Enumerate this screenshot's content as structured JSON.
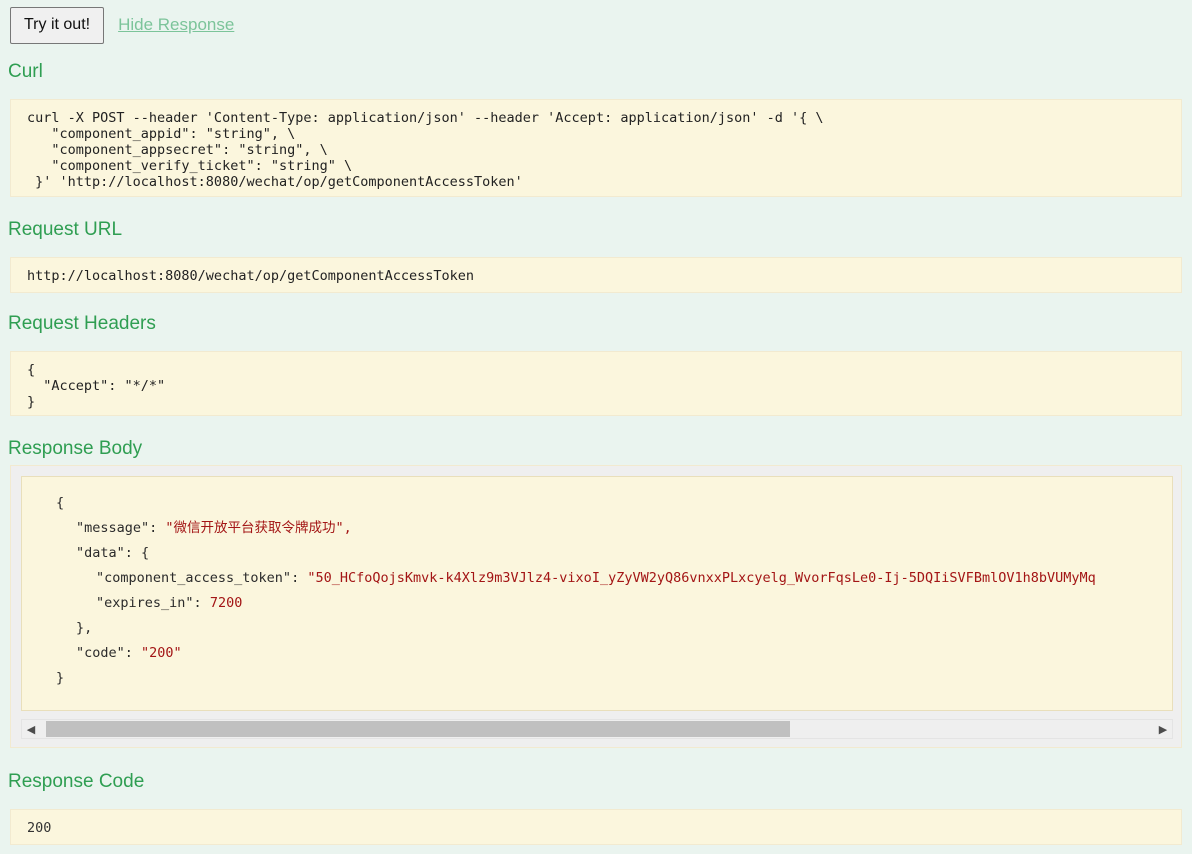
{
  "actions": {
    "try_it_out_label": "Try it out!",
    "hide_response_label": "Hide Response"
  },
  "sections": {
    "curl": {
      "title": "Curl",
      "lines": [
        "curl -X POST --header 'Content-Type: application/json' --header 'Accept: application/json' -d '{ \\",
        "   \"component_appid\": \"string\", \\",
        "   \"component_appsecret\": \"string\", \\",
        "   \"component_verify_ticket\": \"string\" \\",
        " }' 'http://localhost:8080/wechat/op/getComponentAccessToken'"
      ]
    },
    "request_url": {
      "title": "Request URL",
      "value": "http://localhost:8080/wechat/op/getComponentAccessToken"
    },
    "request_headers": {
      "title": "Request Headers",
      "value": "{\n  \"Accept\": \"*/*\"\n}"
    },
    "response_body": {
      "title": "Response Body",
      "lines": {
        "open_brace": "{",
        "message_key": "\"message\":",
        "message_val": "\"微信开放平台获取令牌成功\",",
        "data_key": "\"data\": {",
        "token_key": "\"component_access_token\":",
        "token_val": "\"50_HCfoQojsKmvk-k4Xlz9m3VJlz4-vixoI_yZyVW2yQ86vnxxPLxcyelg_WvorFqsLe0-Ij-5DQIiSVFBmlOV1h8bVUMyMq",
        "expires_key": "\"expires_in\":",
        "expires_val": "7200",
        "data_close": "},",
        "code_key": "\"code\":",
        "code_val": "\"200\"",
        "close_brace": "}"
      },
      "scrollbar": {
        "left_arrow": "◀",
        "right_arrow": "▶"
      }
    },
    "response_code": {
      "title": "Response Code",
      "value": "200"
    }
  },
  "colors": {
    "page_background": "#eaf4ef",
    "heading_green": "#2f9e52",
    "link_green": "#7cc49a",
    "code_background": "#fbf6dd",
    "json_string": "#a31515",
    "scrollbar_thumb": "#c0c0c0"
  }
}
